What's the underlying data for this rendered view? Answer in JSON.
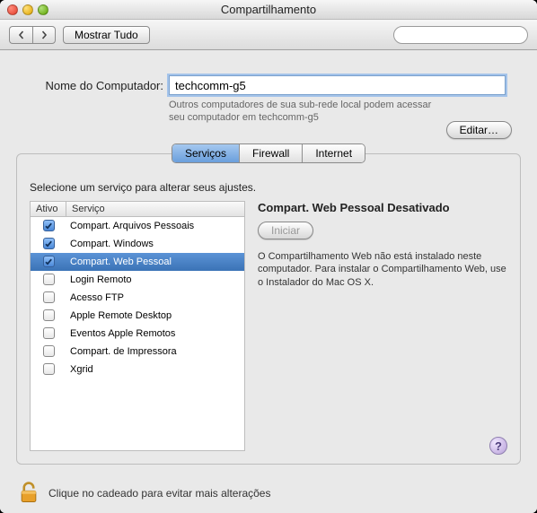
{
  "window": {
    "title": "Compartilhamento"
  },
  "toolbar": {
    "showall_label": "Mostrar Tudo",
    "search_placeholder": ""
  },
  "name": {
    "label": "Nome do Computador:",
    "value": "techcomm-g5",
    "help": "Outros computadores de sua sub-rede local podem acessar seu computador em techcomm-g5",
    "edit_label": "Editar…"
  },
  "tabs": {
    "services": "Serviços",
    "firewall": "Firewall",
    "internet": "Internet"
  },
  "instruction": "Selecione um serviço para alterar seus ajustes.",
  "list": {
    "header_active": "Ativo",
    "header_service": "Serviço",
    "items": [
      {
        "label": "Compart. Arquivos Pessoais",
        "checked": true,
        "selected": false
      },
      {
        "label": "Compart. Windows",
        "checked": true,
        "selected": false
      },
      {
        "label": "Compart. Web Pessoal",
        "checked": true,
        "selected": true
      },
      {
        "label": "Login Remoto",
        "checked": false,
        "selected": false
      },
      {
        "label": "Acesso FTP",
        "checked": false,
        "selected": false
      },
      {
        "label": "Apple Remote Desktop",
        "checked": false,
        "selected": false
      },
      {
        "label": "Eventos Apple Remotos",
        "checked": false,
        "selected": false
      },
      {
        "label": "Compart. de Impressora",
        "checked": false,
        "selected": false
      },
      {
        "label": "Xgrid",
        "checked": false,
        "selected": false
      }
    ]
  },
  "detail": {
    "heading": "Compart. Web Pessoal Desativado",
    "start_label": "Iniciar",
    "body": "O Compartilhamento Web não está instalado neste computador. Para instalar o Compartilhamento Web, use o Instalador do Mac OS X."
  },
  "help_glyph": "?",
  "lock": {
    "text": "Clique no cadeado para evitar mais alterações"
  }
}
